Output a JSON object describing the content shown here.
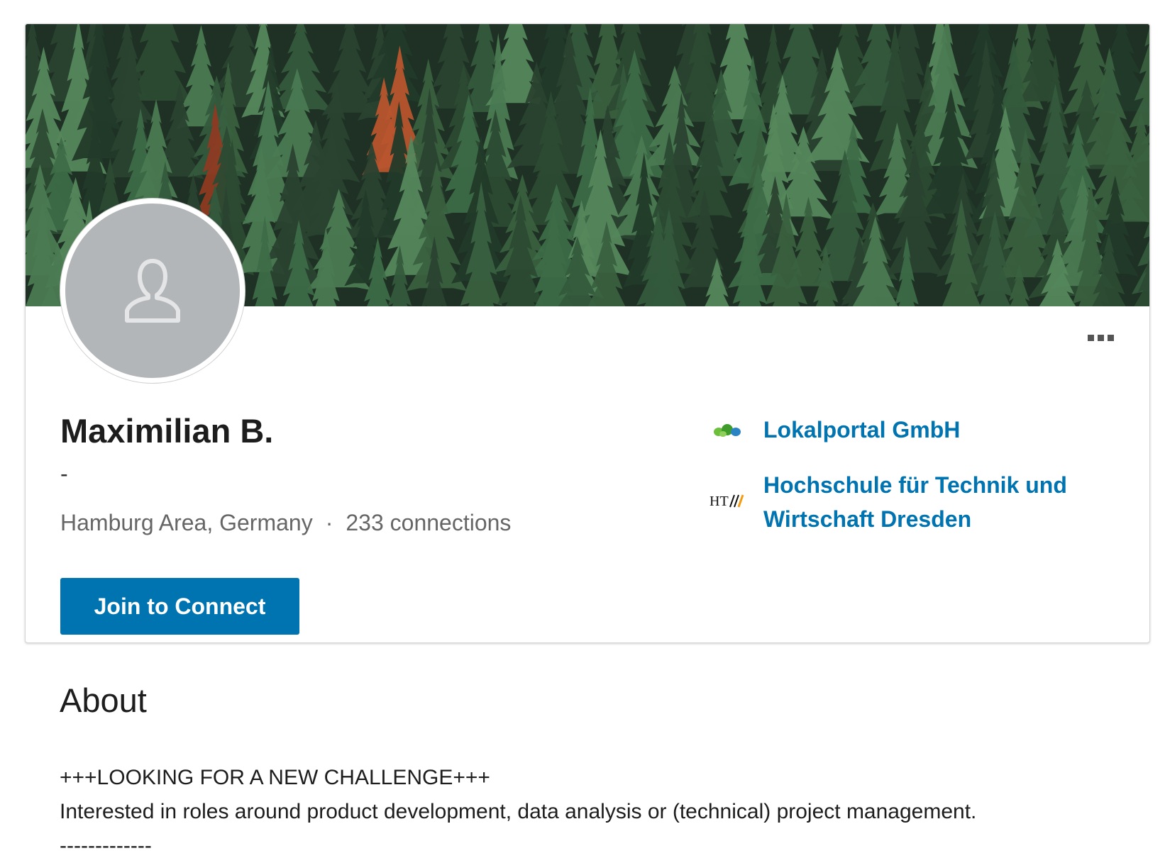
{
  "profile": {
    "name": "Maximilian B.",
    "headline": "-",
    "location": "Hamburg Area, Germany",
    "separator": "·",
    "connections": "233 connections",
    "join_label": "Join to Connect",
    "more_icon": "more-options-icon"
  },
  "organizations": [
    {
      "name": "Lokalportal GmbH",
      "logo": "lokalportal-logo"
    },
    {
      "name": "Hochschule für Technik und Wirtschaft Dresden",
      "logo": "htw-logo"
    }
  ],
  "about": {
    "title": "About",
    "line1": "+++LOOKING FOR A NEW CHALLENGE+++",
    "line2": "Interested in roles around product development, data analysis or (technical) project management.",
    "line3": "-------------"
  },
  "colors": {
    "link": "#0073b1",
    "button": "#0073b1",
    "avatar_bg": "#b3b6b9",
    "cover": "#1f3326"
  }
}
